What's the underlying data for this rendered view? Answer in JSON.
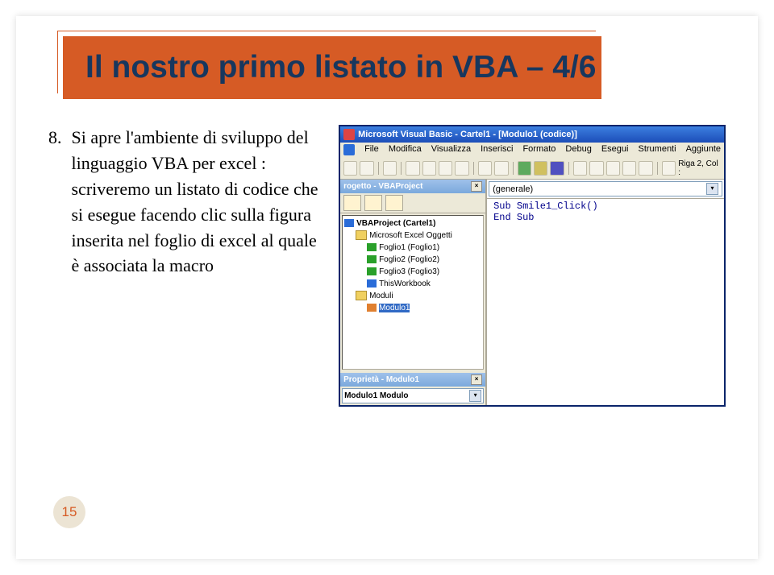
{
  "slide": {
    "title": "Il nostro primo listato in VBA – 4/6",
    "bullet_number": "8.",
    "bullet_text": "Si apre l'ambiente di sviluppo del linguaggio VBA per excel : scriveremo un listato di codice che si esegue facendo clic sulla figura inserita nel foglio di excel al quale è associata la macro",
    "page_number": "15"
  },
  "vbe": {
    "title": "Microsoft Visual Basic - Cartel1 - [Modulo1 (codice)]",
    "menu": [
      "File",
      "Modifica",
      "Visualizza",
      "Inserisci",
      "Formato",
      "Debug",
      "Esegui",
      "Strumenti",
      "Aggiunte"
    ],
    "cursor_pos": "Riga 2, Col :",
    "project_panel_title": "rogetto - VBAProject",
    "tree": {
      "root": "VBAProject (Cartel1)",
      "folder1": "Microsoft Excel Oggetti",
      "sheets": [
        "Foglio1 (Foglio1)",
        "Foglio2 (Foglio2)",
        "Foglio3 (Foglio3)"
      ],
      "workbook": "ThisWorkbook",
      "folder2": "Moduli",
      "module": "Modulo1"
    },
    "properties_title": "Proprietà - Modulo1",
    "properties_object": "Modulo1 Modulo",
    "code_object_dd": "(generale)",
    "code": {
      "line1": "Sub Smile1_Click()",
      "line2": "",
      "line3": "End Sub"
    }
  }
}
